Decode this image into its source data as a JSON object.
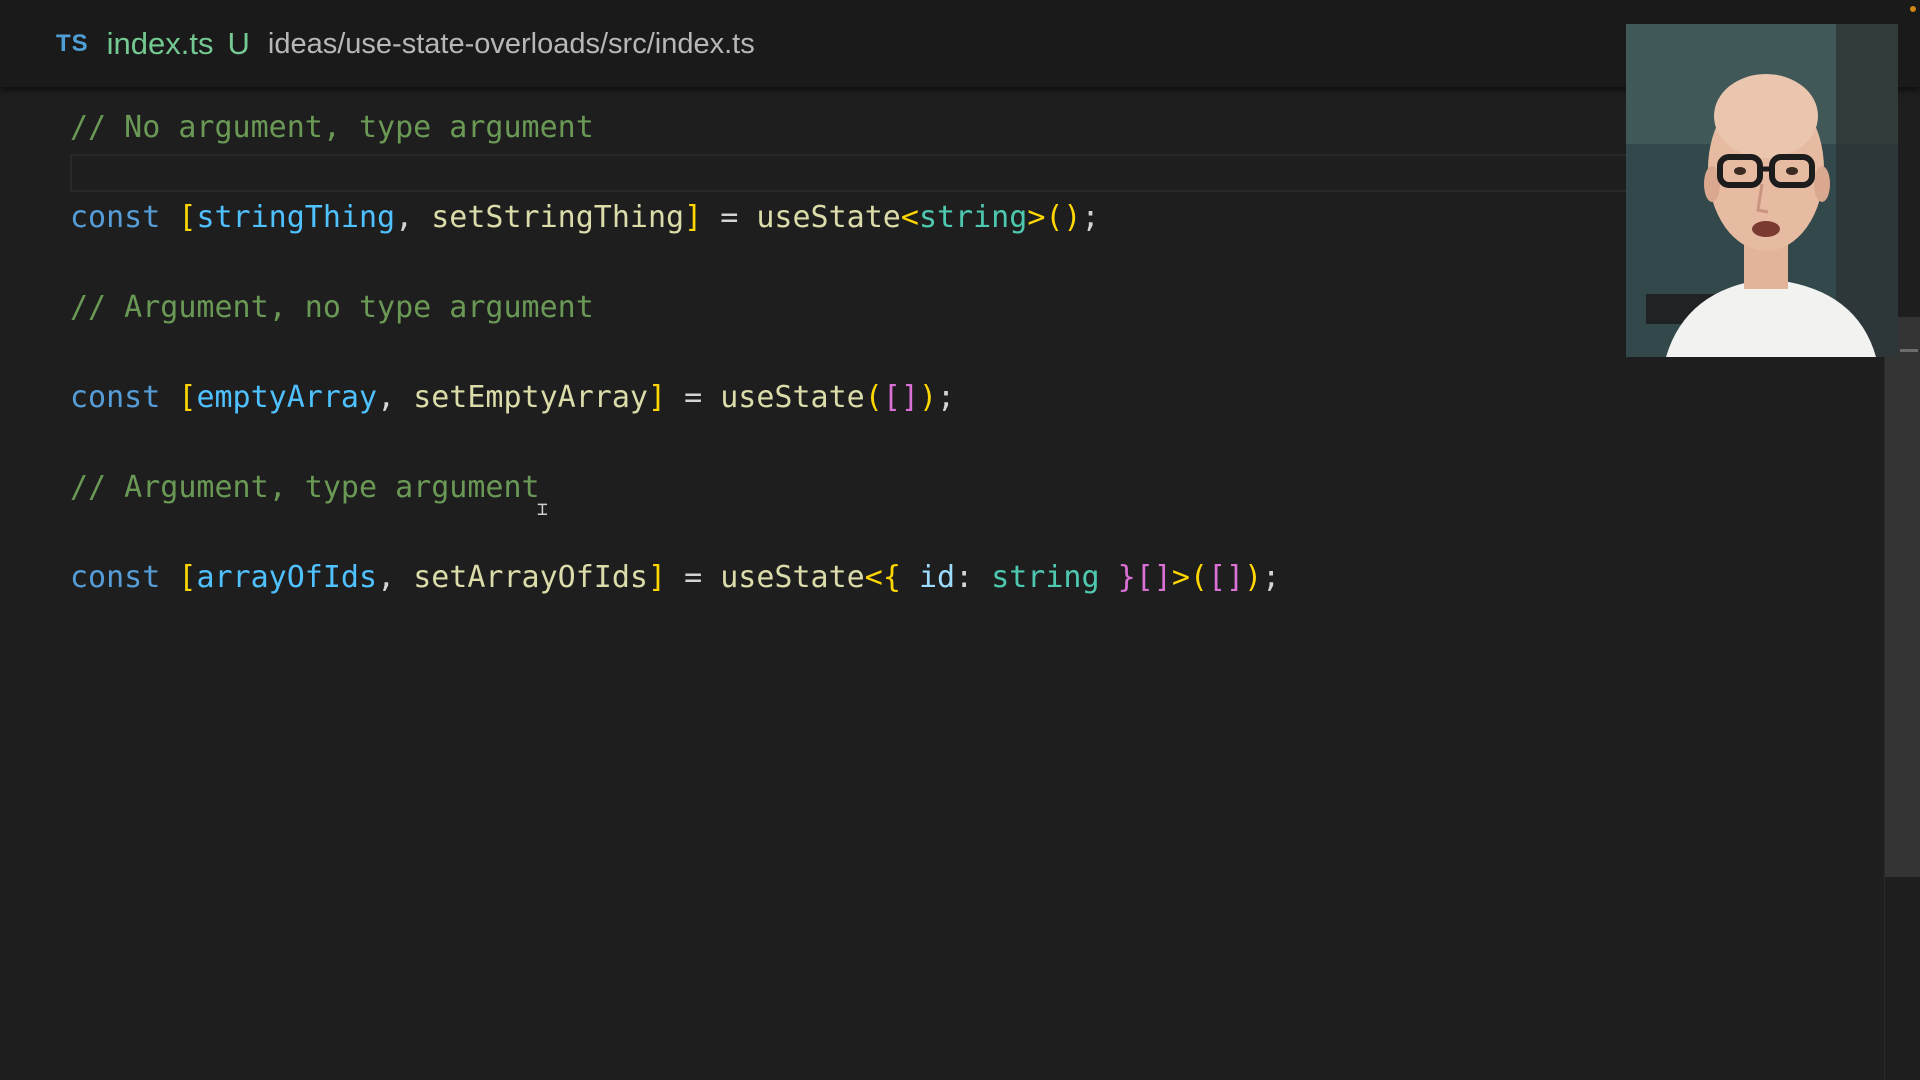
{
  "tab": {
    "language_badge": "TS",
    "filename": "index.ts",
    "git_status": "U",
    "path": "ideas/use-state-overloads/src/index.ts"
  },
  "colors": {
    "background": "#1e1e1e",
    "comment": "#6a9955",
    "keyword": "#569cd6",
    "variable": "#4fc1ff",
    "function": "#dcdcaa",
    "type": "#4ec9b0",
    "bracket_gold": "#ffd700",
    "bracket_purple": "#da70d6",
    "property": "#9cdcfe",
    "git_untracked": "#73c991"
  },
  "code": {
    "line1": [
      {
        "t": "// No argument, type argument",
        "k": "comment"
      }
    ],
    "line2": [
      {
        "t": "const ",
        "k": "keyword"
      },
      {
        "t": "[",
        "k": "bracket_gold"
      },
      {
        "t": "stringThing",
        "k": "variable"
      },
      {
        "t": ", ",
        "k": "plain"
      },
      {
        "t": "setStringThing",
        "k": "function"
      },
      {
        "t": "]",
        "k": "bracket_gold"
      },
      {
        "t": " = ",
        "k": "plain"
      },
      {
        "t": "useState",
        "k": "function"
      },
      {
        "t": "<",
        "k": "bracket_gold"
      },
      {
        "t": "string",
        "k": "type"
      },
      {
        "t": ">",
        "k": "bracket_gold"
      },
      {
        "t": "()",
        "k": "bracket_gold"
      },
      {
        "t": ";",
        "k": "plain"
      }
    ],
    "line3": [
      {
        "t": "// Argument, no type argument",
        "k": "comment"
      }
    ],
    "line4": [
      {
        "t": "const ",
        "k": "keyword"
      },
      {
        "t": "[",
        "k": "bracket_gold"
      },
      {
        "t": "emptyArray",
        "k": "variable"
      },
      {
        "t": ", ",
        "k": "plain"
      },
      {
        "t": "setEmptyArray",
        "k": "function"
      },
      {
        "t": "]",
        "k": "bracket_gold"
      },
      {
        "t": " = ",
        "k": "plain"
      },
      {
        "t": "useState",
        "k": "function"
      },
      {
        "t": "(",
        "k": "bracket_gold"
      },
      {
        "t": "[]",
        "k": "bracket_purple"
      },
      {
        "t": ")",
        "k": "bracket_gold"
      },
      {
        "t": ";",
        "k": "plain"
      }
    ],
    "line5": [
      {
        "t": "// Argument, type argument",
        "k": "comment"
      }
    ],
    "line6": [
      {
        "t": "const ",
        "k": "keyword"
      },
      {
        "t": "[",
        "k": "bracket_gold"
      },
      {
        "t": "arrayOfIds",
        "k": "variable"
      },
      {
        "t": ", ",
        "k": "plain"
      },
      {
        "t": "setArrayOfIds",
        "k": "function"
      },
      {
        "t": "]",
        "k": "bracket_gold"
      },
      {
        "t": " = ",
        "k": "plain"
      },
      {
        "t": "useState",
        "k": "function"
      },
      {
        "t": "<",
        "k": "bracket_gold"
      },
      {
        "t": "{",
        "k": "bracket_gold"
      },
      {
        "t": " ",
        "k": "plain"
      },
      {
        "t": "id",
        "k": "property"
      },
      {
        "t": ": ",
        "k": "plain"
      },
      {
        "t": "string",
        "k": "type"
      },
      {
        "t": " ",
        "k": "plain"
      },
      {
        "t": "}",
        "k": "bracket_purple"
      },
      {
        "t": "[]",
        "k": "bracket_purple"
      },
      {
        "t": ">",
        "k": "bracket_gold"
      },
      {
        "t": "(",
        "k": "bracket_gold"
      },
      {
        "t": "[]",
        "k": "bracket_purple"
      },
      {
        "t": ")",
        "k": "bracket_gold"
      },
      {
        "t": ";",
        "k": "plain"
      }
    ]
  }
}
